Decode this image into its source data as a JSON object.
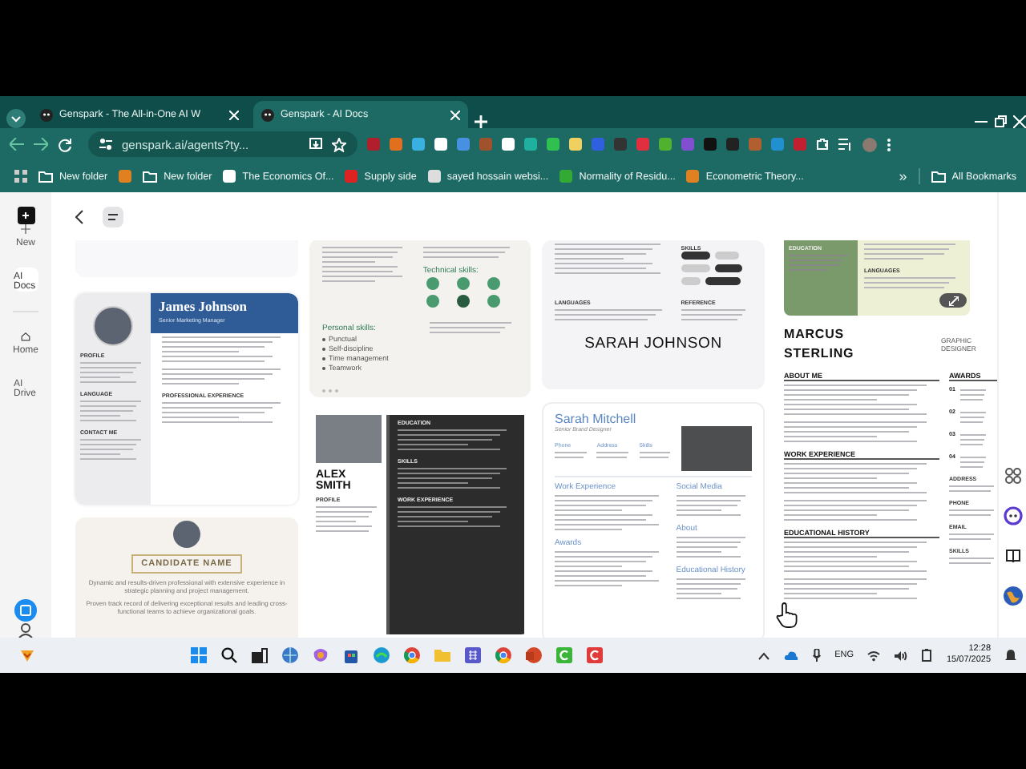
{
  "browser": {
    "tabs": [
      {
        "title": "Genspark - The All-in-One AI W",
        "selected": false
      },
      {
        "title": "Genspark - AI Docs",
        "selected": true
      }
    ],
    "address": "genspark.ai/agents?ty...",
    "bookmarks": [
      {
        "label": "New folder",
        "kind": "folder"
      },
      {
        "kind": "icon-only"
      },
      {
        "label": "New folder",
        "kind": "folder"
      },
      {
        "label": "The Economics Of...",
        "kind": "site"
      },
      {
        "label": "Supply side",
        "kind": "site"
      },
      {
        "label": "sayed hossain websi...",
        "kind": "site"
      },
      {
        "label": "Normality of Residu...",
        "kind": "site"
      },
      {
        "label": "Econometric Theory...",
        "kind": "site"
      }
    ],
    "bookmarks_more": "»",
    "all_bookmarks": "All Bookmarks"
  },
  "sidebar": {
    "items": [
      {
        "label": "New",
        "selected": false
      },
      {
        "label": "AI Docs",
        "selected": true
      },
      {
        "label": "Home",
        "selected": false
      },
      {
        "label": "AI Drive",
        "selected": false
      }
    ]
  },
  "columns": [
    [
      {
        "kind": "blank"
      },
      {
        "kind": "sidebar-photo",
        "name": "James Johnson",
        "role": "Senior Marketing Manager",
        "left_headings": [
          "PROFILE",
          "LANGUAGE",
          "CONTACT ME"
        ],
        "right_headings": [
          "PROFESSIONAL EXPERIENCE"
        ]
      },
      {
        "kind": "centered",
        "name": "CANDIDATE NAME",
        "summary": [
          "Dynamic and results-driven professional with extensive experience in strategic planning and project management.",
          "Proven track record of delivering exceptional results and leading cross-functional teams to achieve organizational goals."
        ]
      }
    ],
    [
      {
        "kind": "skills-green",
        "headings": [
          "Technical skills:",
          "Personal skills:"
        ],
        "personal": [
          "Punctual",
          "Self-discipline",
          "Time management",
          "Teamwork"
        ]
      },
      {
        "kind": "dark-column",
        "first": "ALEX",
        "last": "SMITH",
        "left_headings": [
          "PROFILE"
        ],
        "right_headings": [
          "EDUCATION",
          "SKILLS",
          "WORK EXPERIENCE"
        ]
      }
    ],
    [
      {
        "kind": "chips",
        "skills_heading": "SKILLS",
        "languages_heading": "LANGUAGES",
        "reference_heading": "REFERENCE",
        "name": "SARAH JOHNSON"
      },
      {
        "kind": "blue-accent",
        "name": "Sarah Mitchell",
        "role": "Senior Brand Designer",
        "info_labels": [
          "Phone",
          "Address",
          "Skills"
        ],
        "left_headings": [
          "Work Experience",
          "Awards"
        ],
        "right_headings": [
          "Social Media",
          "About",
          "Educational History"
        ]
      }
    ],
    [
      {
        "kind": "bold-header",
        "top_headings": [
          "EDUCATION",
          "LANGUAGES"
        ],
        "first": "MARCUS",
        "last": "STERLING",
        "title": "GRAPHIC DESIGNER",
        "main_headings": [
          "ABOUT ME",
          "WORK EXPERIENCE",
          "EDUCATIONAL HISTORY"
        ],
        "side_heading": "AWARDS",
        "award_numbers": [
          "01",
          "02",
          "03",
          "04"
        ],
        "contact_headings": [
          "ADDRESS",
          "PHONE",
          "EMAIL",
          "SKILLS"
        ]
      }
    ]
  ],
  "taskbar": {
    "language": "ENG",
    "time": "12:28",
    "date": "15/07/2025"
  }
}
